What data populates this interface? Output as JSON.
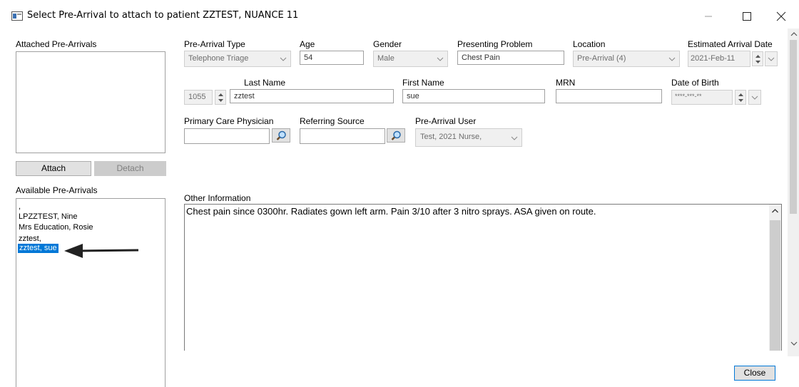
{
  "window": {
    "title": "Select Pre-Arrival to attach to patient ZZTEST, NUANCE 11",
    "minimize_icon": "minimize-icon",
    "maximize_icon": "maximize-icon",
    "close_icon": "close-icon"
  },
  "left_panel": {
    "attached_label": "Attached Pre-Arrivals",
    "attach_button": "Attach",
    "detach_button": "Detach",
    "available_label": "Available Pre-Arrivals",
    "available_items": [
      ",",
      "LPZZTEST, Nine",
      "Mrs Education, Rosie",
      "zztest,",
      "zztest, sue"
    ],
    "selected_item": "zztest, sue"
  },
  "form": {
    "pre_arrival_type_label": "Pre-Arrival Type",
    "pre_arrival_type_value": "Telephone Triage",
    "age_label": "Age",
    "age_value": "54",
    "gender_label": "Gender",
    "gender_value": "Male",
    "presenting_problem_label": "Presenting Problem",
    "presenting_problem_value": "Chest Pain",
    "location_label": "Location",
    "location_value": "Pre-Arrival (4)",
    "eta_label": "Estimated Arrival Date",
    "eta_value": "2021-Feb-11",
    "id_value": "1055",
    "last_name_label": "Last Name",
    "last_name_value": "zztest",
    "first_name_label": "First Name",
    "first_name_value": "sue",
    "mrn_label": "MRN",
    "mrn_value": "",
    "dob_label": "Date of Birth",
    "dob_value": "****-***-**",
    "pcp_label": "Primary Care Physician",
    "pcp_value": "",
    "referring_label": "Referring Source",
    "referring_value": "",
    "pre_arrival_user_label": "Pre-Arrival User",
    "pre_arrival_user_value": "Test, 2021 Nurse,",
    "other_info_label": "Other Information",
    "other_info_value": "Chest pain since 0300hr. Radiates gown left arm.  Pain 3/10 after 3 nitro sprays.  ASA given on route."
  },
  "footer": {
    "close_button": "Close"
  },
  "colors": {
    "selection": "#0078d7",
    "disabled_bg": "#f0f0f0",
    "border": "#a0a0a0"
  }
}
